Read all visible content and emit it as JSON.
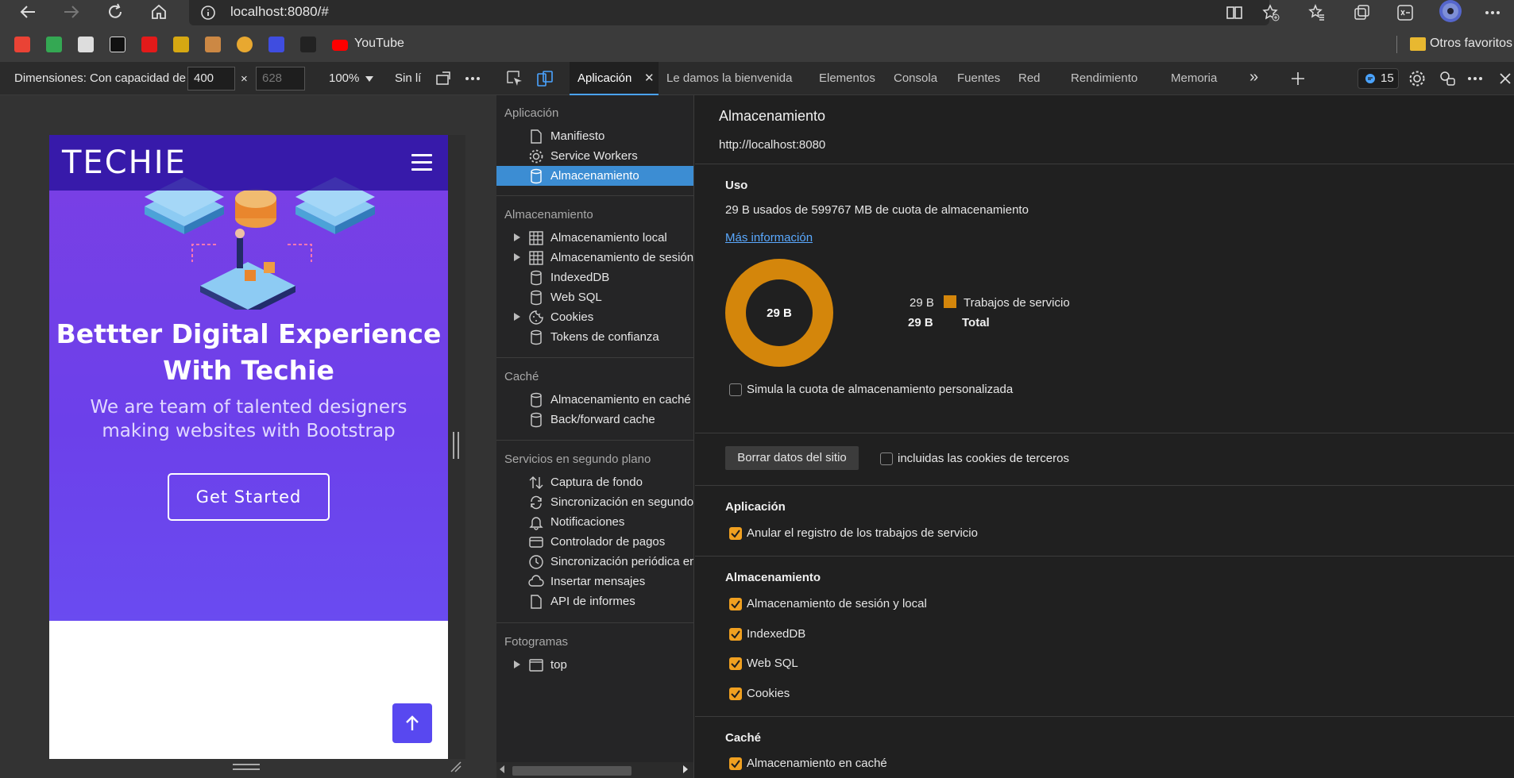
{
  "browser": {
    "address": "localhost:8080/#",
    "bookmarks_youtube": "YouTube",
    "bookmarks_other": "Otros favoritos"
  },
  "device_toolbar": {
    "dimensions_label": "Dimensiones: Con capacidad de",
    "width_value": "400",
    "height_placeholder": "628",
    "times": "×",
    "zoom": "100%",
    "throttle": "Sin lí"
  },
  "site": {
    "logo": "TECHIE",
    "hero_title": "Bettter Digital Experience With Techie",
    "hero_subtitle": "We are team of talented designers making websites with Bootstrap",
    "cta": "Get Started"
  },
  "devtools": {
    "tabs": [
      "Le damos la bienvenida",
      "Elementos",
      "Consola",
      "Fuentes",
      "Red",
      "Rendimiento",
      "Memoria"
    ],
    "active_tab": "Aplicación",
    "issues_count": "15"
  },
  "sidebar": {
    "sections": {
      "app": "Aplicación",
      "storage": "Almacenamiento",
      "cache": "Caché",
      "background": "Servicios en segundo plano",
      "frames": "Fotogramas"
    },
    "app_items": [
      "Manifiesto",
      "Service Workers",
      "Almacenamiento"
    ],
    "storage_items": [
      "Almacenamiento local",
      "Almacenamiento de sesión",
      "IndexedDB",
      "Web SQL",
      "Cookies",
      "Tokens de confianza"
    ],
    "cache_items": [
      "Almacenamiento en caché",
      "Back/forward cache"
    ],
    "background_items": [
      "Captura de fondo",
      "Sincronización en segundo",
      "Notificaciones",
      "Controlador de pagos",
      "Sincronización periódica en",
      "Insertar mensajes",
      "API de informes"
    ],
    "frames_items": [
      "top"
    ]
  },
  "main": {
    "title": "Almacenamiento",
    "origin": "http://localhost:8080",
    "usage": {
      "heading": "Uso",
      "summary": "29 B usados de 599767 MB de cuota de almacenamiento",
      "more_info": "Más información",
      "donut_label": "29 B",
      "legend": [
        {
          "value": "29 B",
          "label": "Trabajos de servicio",
          "color": "#d4860b"
        },
        {
          "value": "29 B",
          "label": "Total"
        }
      ],
      "simulate_quota": "Simula la cuota de almacenamiento personalizada"
    },
    "clear_button": "Borrar datos del sitio",
    "third_party": "incluidas las cookies de terceros",
    "app_section": {
      "heading": "Aplicación",
      "items": [
        "Anular el registro de los trabajos de servicio"
      ]
    },
    "storage_section": {
      "heading": "Almacenamiento",
      "items": [
        "Almacenamiento de sesión y local",
        "IndexedDB",
        "Web SQL",
        "Cookies"
      ]
    },
    "cache_section": {
      "heading": "Caché",
      "items": [
        "Almacenamiento en caché"
      ]
    }
  }
}
